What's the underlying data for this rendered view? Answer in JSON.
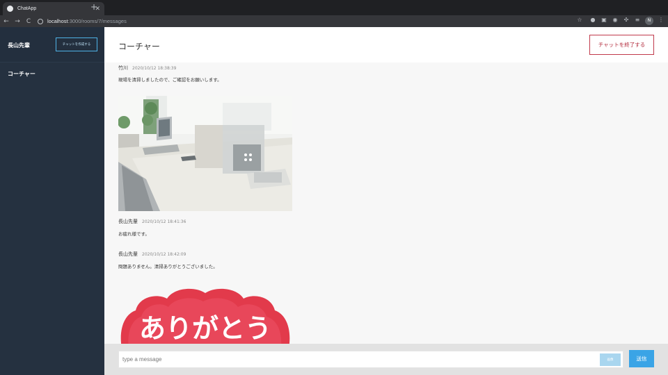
{
  "browser": {
    "tab_title": "ChatApp",
    "tab_close": "✕",
    "new_tab": "+",
    "url_host": "localhost",
    "url_path": ":3000/rooms/7/messages",
    "back": "←",
    "forward": "→",
    "reload": "C",
    "profile_initial": "N"
  },
  "sidebar": {
    "user_name": "長山先輩",
    "create_button": "チャットを作成する",
    "rooms": [
      {
        "label": "コーチャー"
      }
    ]
  },
  "main": {
    "room_title": "コーチャー",
    "end_button": "チャットを終了する"
  },
  "messages": [
    {
      "author": "竹川",
      "time": "2020/10/12 18:38:39",
      "text": "現場を清掃しましたので、ご確認をお願いします。"
    },
    {
      "author": "長山先輩",
      "time": "2020/10/12 18:41:36",
      "text": "お疲れ様です。"
    },
    {
      "author": "長山先輩",
      "time": "2020/10/12 18:42:09",
      "text": "問題ありません。清掃ありがとうございました。"
    }
  ],
  "sticker_text": "ありがとう",
  "composer": {
    "placeholder": "type a message",
    "image_button": "画像",
    "send_button": "送信"
  }
}
